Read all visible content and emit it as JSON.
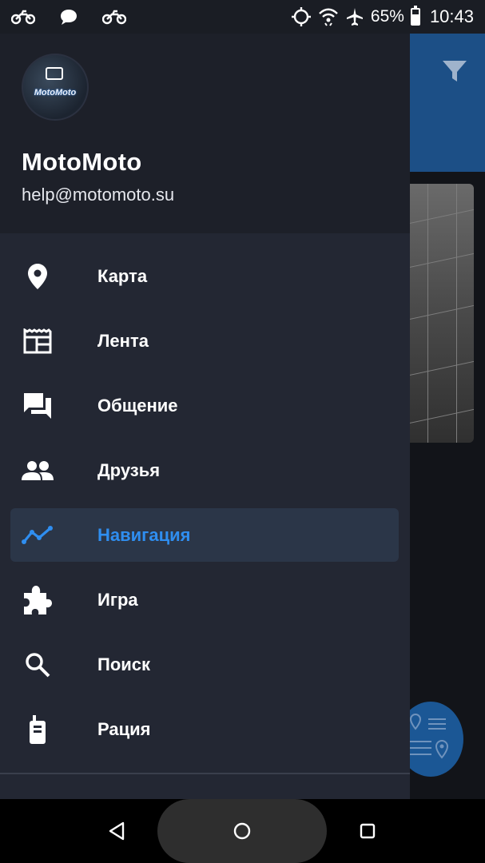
{
  "status_bar": {
    "battery_percent": "65%",
    "battery_level": 0.65,
    "time": "10:43",
    "left_icons": [
      "motorcycle-icon",
      "chat-bubble-icon",
      "motorcycle-icon"
    ],
    "right_icons": [
      "location-target-icon",
      "wifi-icon",
      "airplane-icon",
      "battery-icon"
    ]
  },
  "drawer": {
    "avatar_text": "MotoMoto",
    "user_name": "MotoMoto",
    "user_email": "help@motomoto.su",
    "items": [
      {
        "label": "Карта",
        "icon": "map-pin-icon"
      },
      {
        "label": "Лента",
        "icon": "feed-icon"
      },
      {
        "label": "Общение",
        "icon": "forum-icon"
      },
      {
        "label": "Друзья",
        "icon": "people-icon"
      },
      {
        "label": "Навигация",
        "icon": "trend-line-icon",
        "active": true
      },
      {
        "label": "Игра",
        "icon": "puzzle-icon"
      },
      {
        "label": "Поиск",
        "icon": "search-icon"
      },
      {
        "label": "Рация",
        "icon": "walkie-talkie-icon"
      }
    ]
  },
  "background": {
    "header_color": "#1c4f86",
    "filter_icon": "filter-icon",
    "fab_icon": "route-list-icon"
  },
  "colors": {
    "accent": "#2f8ef0",
    "drawer_bg": "#232733",
    "drawer_header_bg": "#1d2029",
    "active_bg": "#2b3648"
  },
  "nav_bar": {
    "buttons": [
      "back-icon",
      "home-icon",
      "recents-icon"
    ]
  }
}
